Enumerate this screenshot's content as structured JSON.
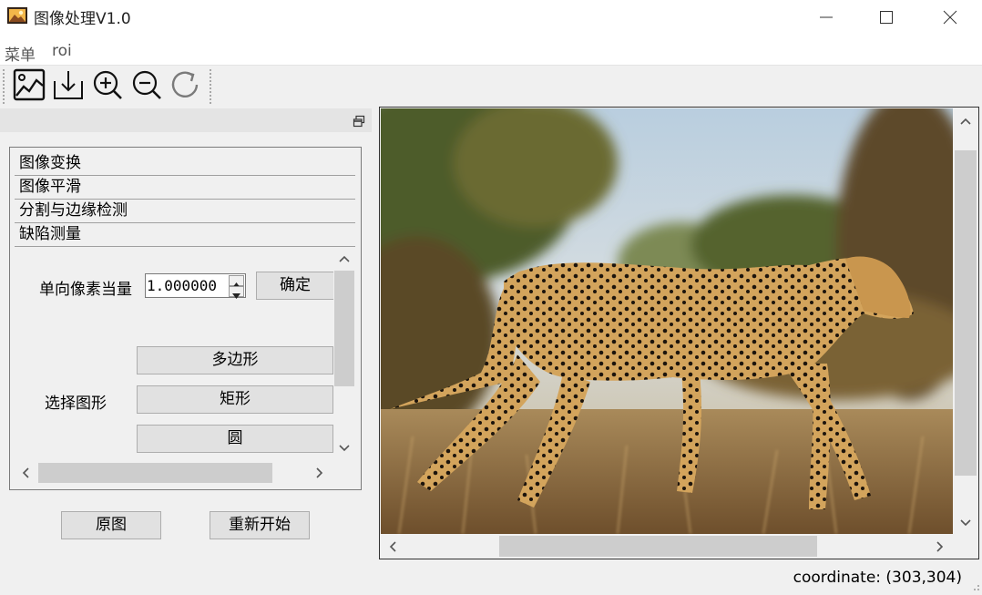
{
  "window": {
    "title": "图像处理V1.0",
    "controls": [
      "minimize",
      "maximize",
      "close"
    ]
  },
  "menu": {
    "items": [
      {
        "label": "菜单"
      },
      {
        "label": "roi"
      }
    ]
  },
  "toolbar": {
    "tools": [
      {
        "icon": "open-image-icon"
      },
      {
        "icon": "save-download-icon"
      },
      {
        "icon": "zoom-in-icon"
      },
      {
        "icon": "zoom-out-icon"
      },
      {
        "icon": "rotate-refresh-icon"
      }
    ]
  },
  "toolbox": {
    "tabs": [
      {
        "label": "图像变换"
      },
      {
        "label": "图像平滑"
      },
      {
        "label": "分割与边缘检测"
      },
      {
        "label": "缺陷测量"
      }
    ],
    "defect": {
      "pixel_equivalent_label": "单向像素当量",
      "pixel_equivalent_value": "1.000000",
      "confirm_label": "确定",
      "select_shape_label": "选择图形",
      "shape_buttons": [
        {
          "label": "多边形"
        },
        {
          "label": "矩形"
        },
        {
          "label": "圆"
        }
      ]
    }
  },
  "bottom_buttons": {
    "original_label": "原图",
    "restart_label": "重新开始"
  },
  "status": {
    "coordinate": "coordinate: (303,304)"
  },
  "colors": {
    "window_bg": "#f0f0f0",
    "button_bg": "#e1e1e1",
    "scroll_thumb": "#cdcdcd"
  }
}
